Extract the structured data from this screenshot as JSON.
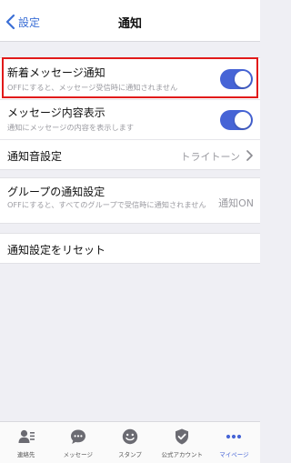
{
  "navbar": {
    "back_label": "設定",
    "title": "通知"
  },
  "rows": {
    "new_message": {
      "title": "新着メッセージ通知",
      "subtitle": "OFFにすると、メッセージ受信時に通知されません",
      "enabled": true
    },
    "message_preview": {
      "title": "メッセージ内容表示",
      "subtitle": "通知にメッセージの内容を表示します",
      "enabled": true
    },
    "sound": {
      "title": "通知音設定",
      "value": "トライトーン"
    },
    "group": {
      "title": "グループの通知設定",
      "subtitle": "OFFにすると、すべてのグループで受信時に通知されません",
      "value": "通知ON"
    },
    "reset": {
      "title": "通知設定をリセット"
    }
  },
  "tabs": [
    {
      "label": "連絡先",
      "icon": "contacts-icon",
      "active": false
    },
    {
      "label": "メッセージ",
      "icon": "message-bubble-icon",
      "active": false
    },
    {
      "label": "スタンプ",
      "icon": "smiley-icon",
      "active": false
    },
    {
      "label": "公式アカウント",
      "icon": "shield-check-icon",
      "active": false
    },
    {
      "label": "マイページ",
      "icon": "more-dots-icon",
      "active": true
    }
  ],
  "colors": {
    "accent": "#4664d6",
    "highlight": "#e11a1a",
    "back": "#3b6fd6"
  }
}
